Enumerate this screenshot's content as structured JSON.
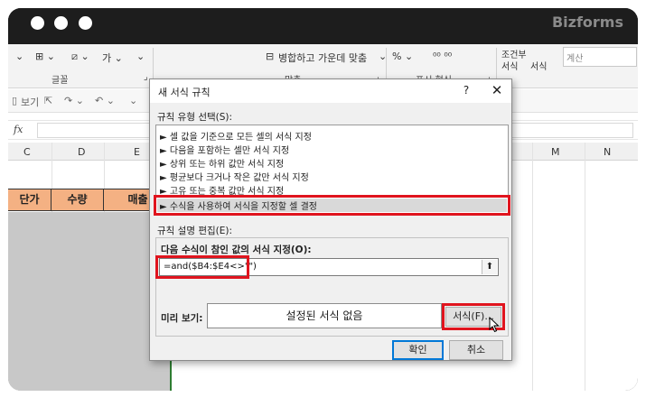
{
  "window": {
    "brand": "Bizforms"
  },
  "ribbon": {
    "groups": {
      "font": "글꼴",
      "alignment": "맞춤",
      "number": "표시 형식"
    },
    "merge_label": "병합하고 가운데 맞춤",
    "conditional_label": "조건부",
    "format_label_1": "서식",
    "format_label_2": "서식",
    "number_format_box": "계산"
  },
  "qat": {
    "view_label": "보기"
  },
  "formula_bar": {
    "fx": "fx",
    "value": ""
  },
  "sheet": {
    "columns": [
      "C",
      "D",
      "E",
      "M",
      "N"
    ],
    "header_cells": [
      "단가",
      "수량",
      "매출"
    ]
  },
  "dialog": {
    "title": "새 서식 규칙",
    "help_glyph": "?",
    "close_glyph": "✕",
    "rule_type_label": "규칙 유형 선택(S):",
    "rule_types": [
      "► 셀 값을 기준으로 모든 셀의 서식 지정",
      "► 다음을 포함하는 셀만 서식 지정",
      "► 상위 또는 하위 값만 서식 지정",
      "► 평균보다 크거나 작은 값만 서식 지정",
      "► 고유 또는 중복 값만 서식 지정",
      "► 수식을 사용하여 서식을 지정할 셀 결정"
    ],
    "selected_rule_index": 5,
    "description_label": "규칙 설명 편집(E):",
    "formula_label": "다음 수식이 참인 값의 서식 지정(O):",
    "formula_value": "=and($B4:$E4<>\"\")",
    "collapse_glyph": "⬆",
    "preview_label": "미리 보기:",
    "preview_text": "설정된 서식 없음",
    "format_button": "서식(F)...",
    "ok_button": "확인",
    "cancel_button": "취소"
  },
  "colors": {
    "highlight_red": "#e0141e",
    "header_fill": "#f4b183",
    "selection_border": "#2e7d32",
    "primary_button_border": "#0078d7"
  }
}
